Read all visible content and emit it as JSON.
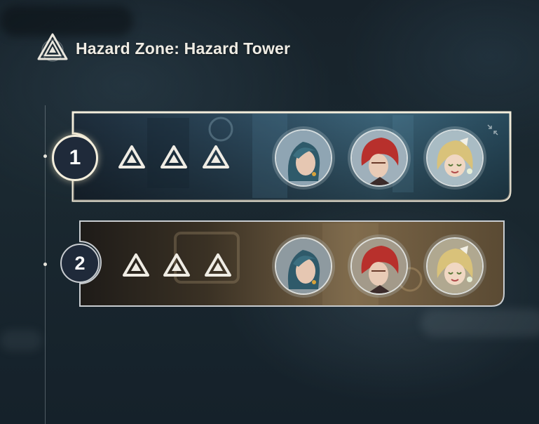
{
  "header": {
    "title": "Hazard Zone: Hazard Tower",
    "emblem_icon": "hazard-triangle-emblem-icon"
  },
  "floors": [
    {
      "number": "1",
      "selected": true,
      "stars": [
        {
          "icon": "hazard-star-icon",
          "earned": true
        },
        {
          "icon": "hazard-star-icon",
          "earned": true
        },
        {
          "icon": "hazard-star-icon",
          "earned": true
        }
      ],
      "team": [
        {
          "character": "teal-haired-character-avatar"
        },
        {
          "character": "red-haired-character-avatar"
        },
        {
          "character": "blonde-haired-character-avatar"
        }
      ],
      "corner_icon": "collapse-icon"
    },
    {
      "number": "2",
      "selected": false,
      "stars": [
        {
          "icon": "hazard-star-icon",
          "earned": true
        },
        {
          "icon": "hazard-star-icon",
          "earned": true
        },
        {
          "icon": "hazard-star-icon",
          "earned": true
        }
      ],
      "team": [
        {
          "character": "teal-haired-character-avatar"
        },
        {
          "character": "red-haired-character-avatar"
        },
        {
          "character": "blonde-haired-character-avatar"
        }
      ]
    }
  ],
  "colors": {
    "selected_border": "#f4eedc",
    "floor1_bg": "#2d4a5c",
    "floor2_bg": "#5a4a33",
    "star": "#efece4"
  }
}
